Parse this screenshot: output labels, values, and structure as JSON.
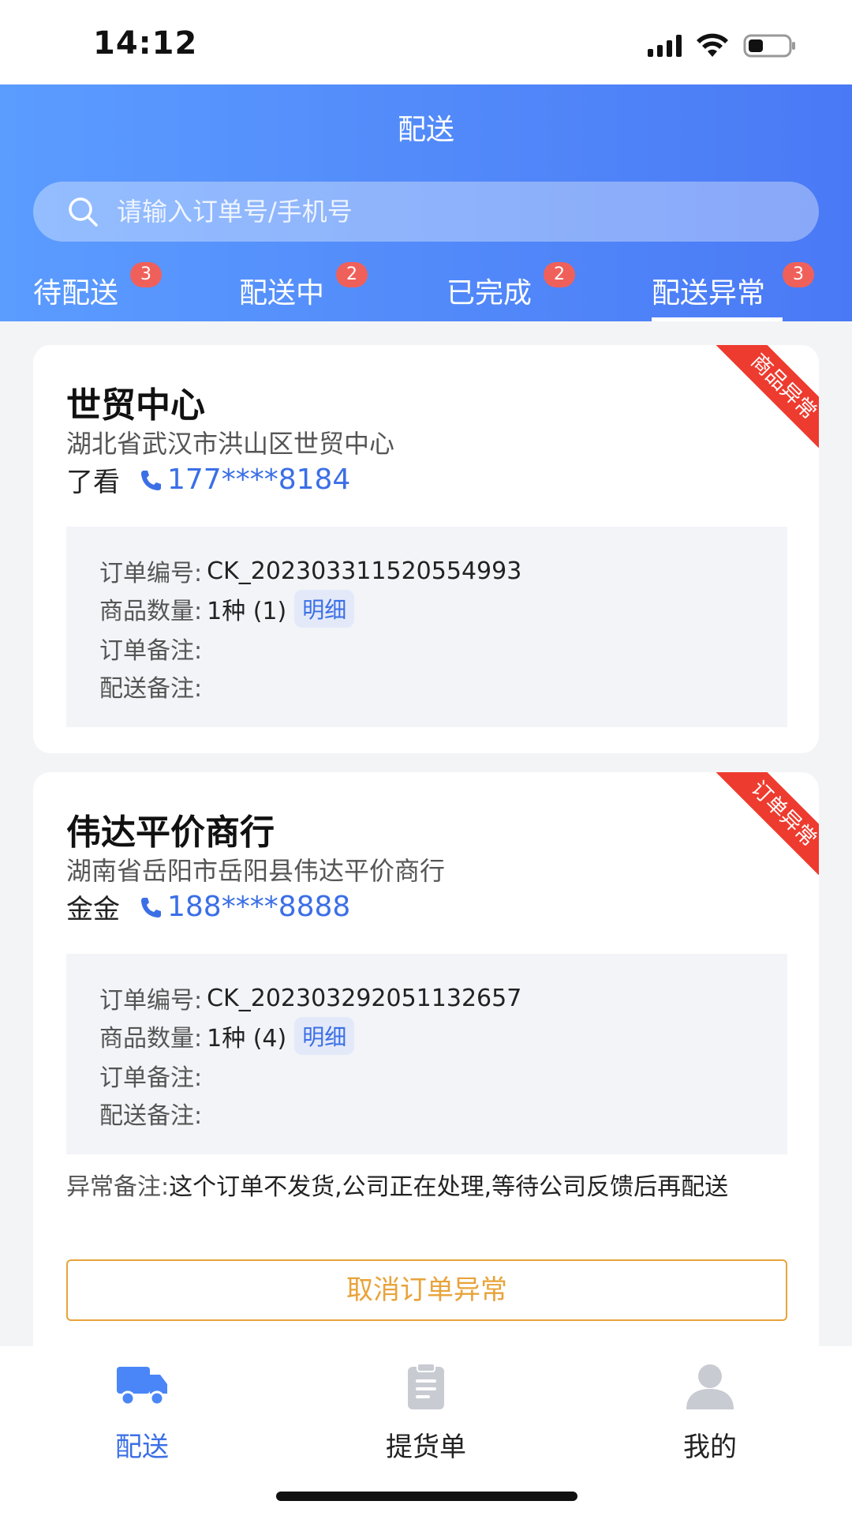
{
  "status_bar": {
    "time": "14:12"
  },
  "header": {
    "title": "配送",
    "search_placeholder": "请输入订单号/手机号"
  },
  "tabs": [
    {
      "label": "待配送",
      "badge": "3"
    },
    {
      "label": "配送中",
      "badge": "2"
    },
    {
      "label": "已完成",
      "badge": "2"
    },
    {
      "label": "配送异常",
      "badge": "3",
      "active": true
    }
  ],
  "orders": [
    {
      "ribbon": "商品异常",
      "store_name": "世贸中心",
      "address": "湖北省武汉市洪山区世贸中心",
      "contact_name": "了看",
      "phone": "177****8184",
      "order_no_label": "订单编号:",
      "order_no": "CK_202303311520554993",
      "qty_label": "商品数量:",
      "qty": "1种 (1)",
      "detail_label": "明细",
      "order_note_label": "订单备注:",
      "delivery_note_label": "配送备注:"
    },
    {
      "ribbon": "订单异常",
      "store_name": "伟达平价商行",
      "address": "湖南省岳阳市岳阳县伟达平价商行",
      "contact_name": "金金",
      "phone": "188****8888",
      "order_no_label": "订单编号:",
      "order_no": "CK_202303292051132657",
      "qty_label": "商品数量:",
      "qty": "1种 (4)",
      "detail_label": "明细",
      "order_note_label": "订单备注:",
      "delivery_note_label": "配送备注:",
      "abnormal_note_label": "异常备注:",
      "abnormal_note": "这个订单不发货,公司正在处理,等待公司反馈后再配送",
      "cancel_button": "取消订单异常"
    }
  ],
  "bottom_nav": [
    {
      "label": "配送",
      "icon": "truck-icon",
      "active": true
    },
    {
      "label": "提货单",
      "icon": "clipboard-icon"
    },
    {
      "label": "我的",
      "icon": "user-icon"
    }
  ],
  "colors": {
    "primary": "#4a79f5",
    "badge": "#f0605a",
    "ribbon": "#ee3b2f",
    "warning": "#e8a33a",
    "link": "#3b6fe6"
  }
}
